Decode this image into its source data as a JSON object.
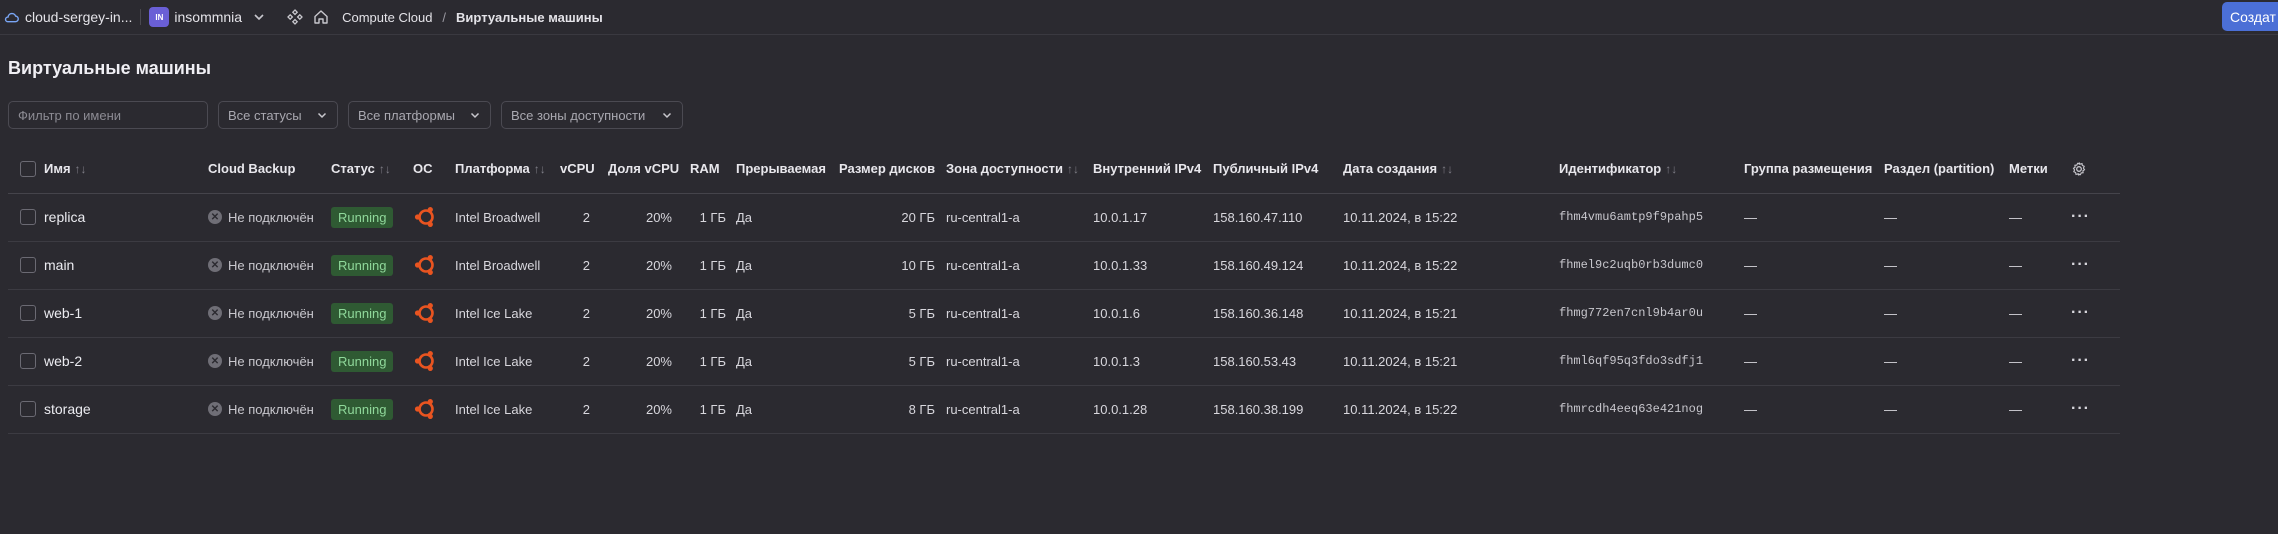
{
  "topbar": {
    "cloud_name": "cloud-sergey-in...",
    "folder_badge": "IN",
    "folder_name": "insommnia",
    "service": "Compute Cloud",
    "slash": "/",
    "current": "Виртуальные машины",
    "create_label": "Создат"
  },
  "page": {
    "title": "Виртуальные машины"
  },
  "filters": {
    "name_placeholder": "Фильтр по имени",
    "status": "Все статусы",
    "platform": "Все платформы",
    "zone": "Все зоны доступности"
  },
  "table": {
    "columns": {
      "name": "Имя",
      "backup": "Cloud Backup",
      "status": "Статус",
      "os": "ОС",
      "platform": "Платформа",
      "vcpu": "vCPU",
      "vcpu_share": "Доля vCPU",
      "ram": "RAM",
      "preemptible": "Прерываемая",
      "disk": "Размер дисков",
      "zone": "Зона доступности",
      "ipv4_int": "Внутренний IPv4",
      "ipv4_pub": "Публичный IPv4",
      "created": "Дата создания",
      "id": "Идентификатор",
      "group": "Группа размещения",
      "partition": "Раздел (partition)",
      "labels": "Метки"
    },
    "rows": [
      {
        "name": "replica",
        "backup": "Не подключён",
        "status": "Running",
        "platform": "Intel Broadwell",
        "vcpu": "2",
        "share": "20%",
        "ram": "1 ГБ",
        "preemptible": "Да",
        "disk": "20 ГБ",
        "zone": "ru-central1-a",
        "ip_int": "10.0.1.17",
        "ip_pub": "158.160.47.110",
        "created": "10.11.2024, в 15:22",
        "id": "fhm4vmu6amtp9f9pahp5",
        "group": "—",
        "partition": "—",
        "labels": "—"
      },
      {
        "name": "main",
        "backup": "Не подключён",
        "status": "Running",
        "platform": "Intel Broadwell",
        "vcpu": "2",
        "share": "20%",
        "ram": "1 ГБ",
        "preemptible": "Да",
        "disk": "10 ГБ",
        "zone": "ru-central1-a",
        "ip_int": "10.0.1.33",
        "ip_pub": "158.160.49.124",
        "created": "10.11.2024, в 15:22",
        "id": "fhmel9c2uqb0rb3dumc0",
        "group": "—",
        "partition": "—",
        "labels": "—"
      },
      {
        "name": "web-1",
        "backup": "Не подключён",
        "status": "Running",
        "platform": "Intel Ice Lake",
        "vcpu": "2",
        "share": "20%",
        "ram": "1 ГБ",
        "preemptible": "Да",
        "disk": "5 ГБ",
        "zone": "ru-central1-a",
        "ip_int": "10.0.1.6",
        "ip_pub": "158.160.36.148",
        "created": "10.11.2024, в 15:21",
        "id": "fhmg772en7cnl9b4ar0u",
        "group": "—",
        "partition": "—",
        "labels": "—"
      },
      {
        "name": "web-2",
        "backup": "Не подключён",
        "status": "Running",
        "platform": "Intel Ice Lake",
        "vcpu": "2",
        "share": "20%",
        "ram": "1 ГБ",
        "preemptible": "Да",
        "disk": "5 ГБ",
        "zone": "ru-central1-a",
        "ip_int": "10.0.1.3",
        "ip_pub": "158.160.53.43",
        "created": "10.11.2024, в 15:21",
        "id": "fhml6qf95q3fdo3sdfj1",
        "group": "—",
        "partition": "—",
        "labels": "—"
      },
      {
        "name": "storage",
        "backup": "Не подключён",
        "status": "Running",
        "platform": "Intel Ice Lake",
        "vcpu": "2",
        "share": "20%",
        "ram": "1 ГБ",
        "preemptible": "Да",
        "disk": "8 ГБ",
        "zone": "ru-central1-a",
        "ip_int": "10.0.1.28",
        "ip_pub": "158.160.38.199",
        "created": "10.11.2024, в 15:22",
        "id": "fhmrcdh4eeq63e421nog",
        "group": "—",
        "partition": "—",
        "labels": "—"
      }
    ],
    "row_menu_glyph": "···",
    "os_icon": "ubuntu-icon",
    "colors": {
      "status_bg": "#2f5a33",
      "status_fg": "#8fd89a",
      "ubuntu": "#e95420",
      "accent": "#4b6fd6"
    }
  }
}
